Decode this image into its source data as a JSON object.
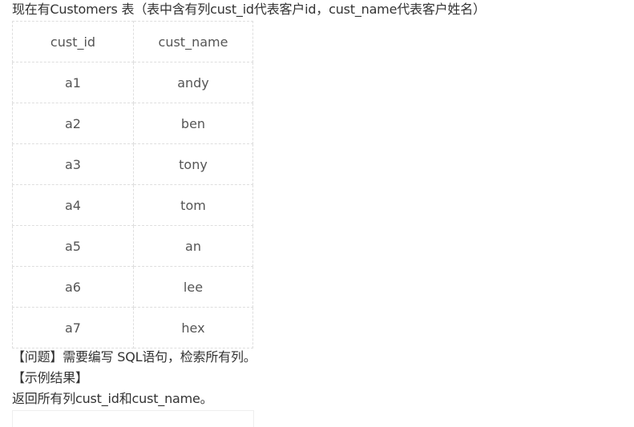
{
  "intro": "现在有Customers 表（表中含有列cust_id代表客户id，cust_name代表客户姓名）",
  "table": {
    "headers": [
      "cust_id",
      "cust_name"
    ],
    "rows": [
      [
        "a1",
        "andy"
      ],
      [
        "a2",
        "ben"
      ],
      [
        "a3",
        "tony"
      ],
      [
        "a4",
        "tom"
      ],
      [
        "a5",
        "an"
      ],
      [
        "a6",
        "lee"
      ],
      [
        "a7",
        "hex"
      ]
    ]
  },
  "question": "【问题】需要编写 SQL语句，检索所有列。",
  "example_heading": "【示例结果】",
  "return_text": "返回所有列cust_id和cust_name。"
}
